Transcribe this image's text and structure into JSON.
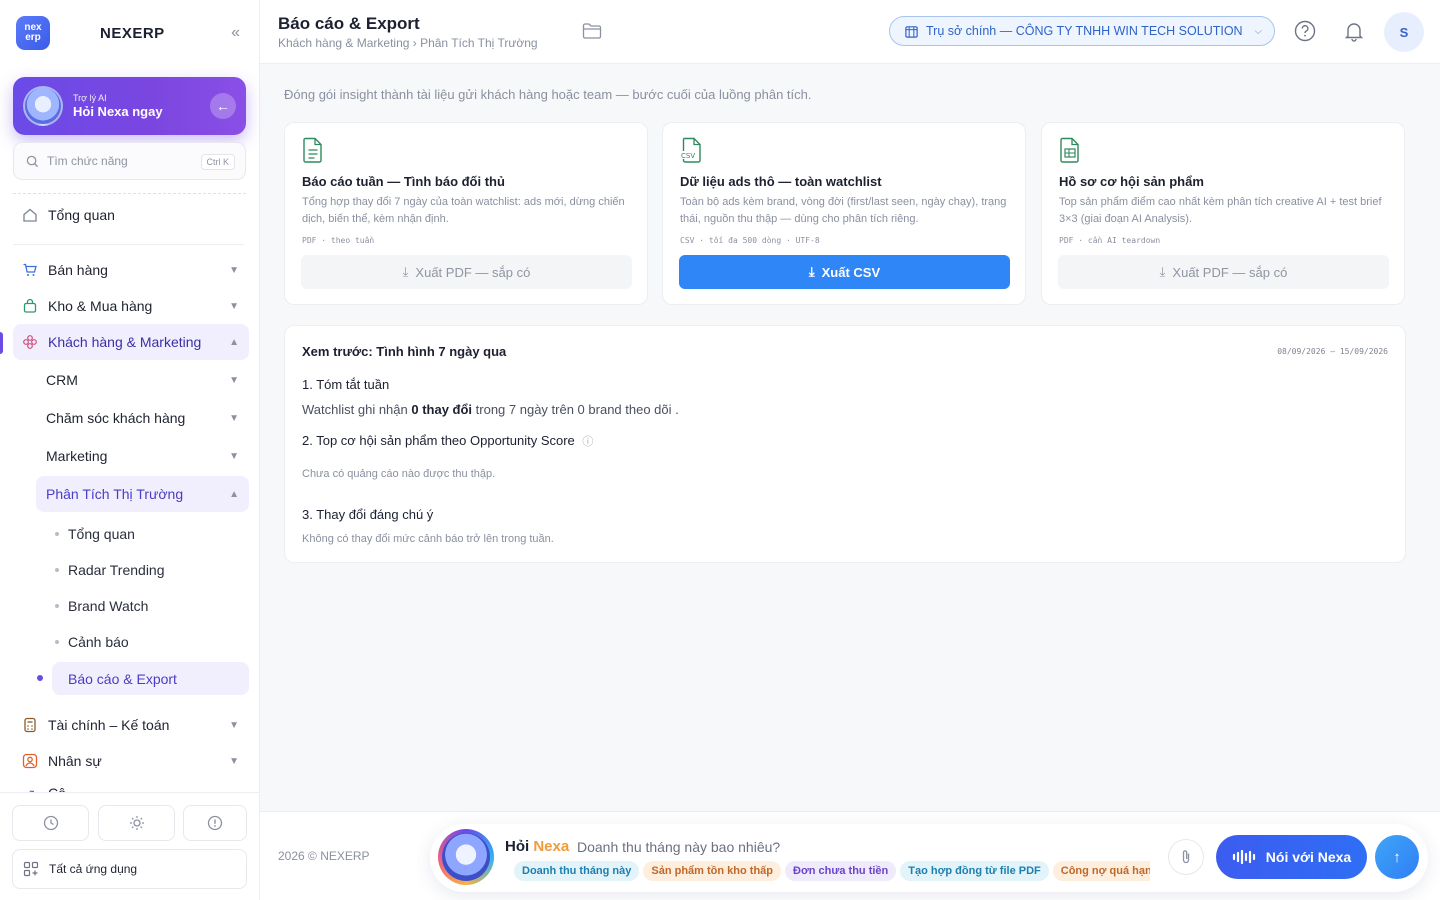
{
  "sidebar": {
    "brand": "NEXERP",
    "logo_top": "nex",
    "logo_bottom": "erp",
    "collapse_icon": "«",
    "ai": {
      "small": "Trợ lý AI",
      "big": "Hỏi Nexa ngay"
    },
    "search": {
      "placeholder": "Tìm chức năng",
      "shortcut": "Ctrl K"
    },
    "overview": "Tổng quan",
    "groups": [
      {
        "label": "Bán hàng"
      },
      {
        "label": "Kho & Mua hàng"
      },
      {
        "label": "Khách hàng & Marketing"
      }
    ],
    "subgroups": [
      {
        "label": "CRM"
      },
      {
        "label": "Chăm sóc khách hàng"
      },
      {
        "label": "Marketing"
      },
      {
        "label": "Phân Tích Thị Trường"
      }
    ],
    "leaves": [
      {
        "label": "Tổng quan"
      },
      {
        "label": "Radar Trending"
      },
      {
        "label": "Brand Watch"
      },
      {
        "label": "Cảnh báo"
      },
      {
        "label": "Báo cáo & Export"
      }
    ],
    "groups_after": [
      {
        "label": "Tài chính – Kế toán"
      },
      {
        "label": "Nhân sự"
      },
      {
        "label": "Cô"
      }
    ],
    "all_apps": "Tất cả ứng dụng"
  },
  "header": {
    "title": "Báo cáo & Export",
    "breadcrumb": "Khách hàng & Marketing › Phân Tích Thị Trường",
    "branch": "Trụ sở chính — CÔNG TY TNHH WIN TECH SOLUTION",
    "avatar": "S"
  },
  "main": {
    "intro": "Đóng gói insight thành tài liệu gửi khách hàng hoặc team — bước cuối của luồng phân tích.",
    "cards": [
      {
        "title": "Báo cáo tuần — Tình báo đối thủ",
        "desc": "Tổng hợp thay đổi 7 ngày của toàn watchlist: ads mới, dừng chiến dịch, biến thể, kèm nhận định.",
        "meta": "PDF · theo tuần",
        "button": "Xuất PDF — sắp có"
      },
      {
        "title": "Dữ liệu ads thô — toàn watchlist",
        "desc": "Toàn bộ ads kèm brand, vòng đời (first/last seen, ngày chạy), trạng thái, nguồn thu thập — dùng cho phân tích riêng.",
        "meta": "CSV · tối đa 500 dòng · UTF-8",
        "button": "Xuất CSV"
      },
      {
        "title": "Hồ sơ cơ hội sản phẩm",
        "desc": "Top sản phẩm điểm cao nhất kèm phân tích creative AI + test brief 3×3 (giai đoạn AI Analysis).",
        "meta": "PDF · cần AI teardown",
        "button": "Xuất PDF — sắp có"
      }
    ],
    "preview": {
      "title": "Xem trước: Tình hình 7 ngày qua",
      "date_range": "08/09/2026 – 15/09/2026",
      "s1_heading": "1. Tóm tắt tuần",
      "s1_pre": "Watchlist ghi nhận ",
      "s1_bold": "0 thay đổi",
      "s1_post": " trong 7 ngày trên 0 brand theo dõi .",
      "s2_heading": "2. Top cơ hội sản phẩm theo Opportunity Score",
      "s2_empty": "Chưa có quảng cáo nào được thu thập.",
      "s3_heading": "3. Thay đổi đáng chú ý",
      "s3_empty": "Không có thay đổi mức cảnh báo trở lên trong tuần."
    }
  },
  "footer": {
    "copyright": "2026 © NEXERP",
    "ask_hoi": "Hỏi",
    "ask_nexa": "Nexa",
    "ask_placeholder": "Doanh thu tháng này bao nhiêu?",
    "chips": [
      {
        "label": "Doanh thu tháng này",
        "color": "#1d7fae",
        "bg": "#e3f3fa"
      },
      {
        "label": "Sản phẩm tồn kho thấp",
        "color": "#c0682a",
        "bg": "#fdeede"
      },
      {
        "label": "Đơn chưa thu tiền",
        "color": "#6a44c9",
        "bg": "#efeafc"
      },
      {
        "label": "Tạo hợp đồng từ file PDF",
        "color": "#1d7fae",
        "bg": "#e3f3fa"
      },
      {
        "label": "Công nợ quá hạn",
        "color": "#c0682a",
        "bg": "#fdeede"
      }
    ],
    "talk": "Nói với Nexa"
  },
  "colors": {
    "accent": "#6a4be8",
    "primary_button": "#2f86f6",
    "branch": "#2f63c8"
  }
}
